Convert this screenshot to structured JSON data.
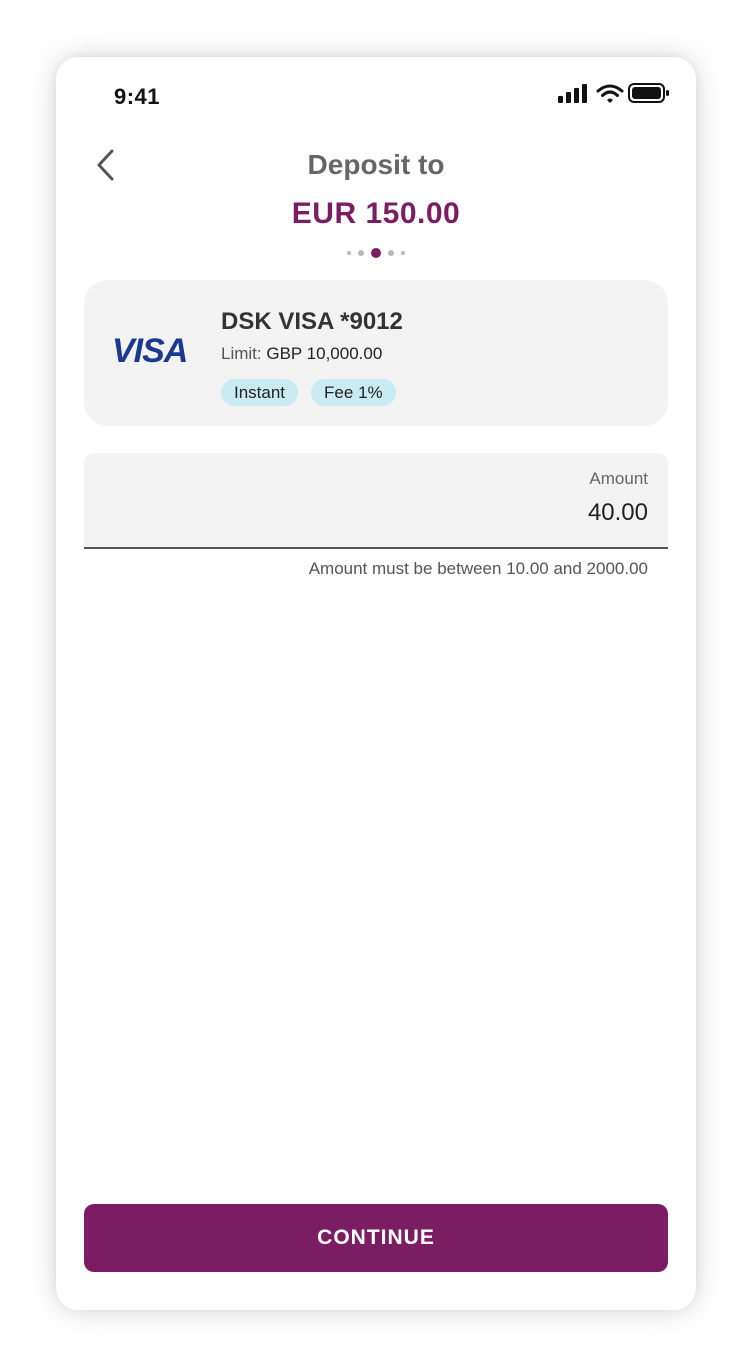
{
  "colors": {
    "brand": "#7a1d62",
    "visa": "#1a3a8f",
    "tag_bg": "#c8ecf1"
  },
  "status_bar": {
    "time": "9:41",
    "icons": [
      "signal-icon",
      "wifi-icon",
      "battery-icon"
    ]
  },
  "header": {
    "back_icon": "chevron-left-icon",
    "title": "Deposit to",
    "amount": "EUR 150.00",
    "stepper": {
      "total_steps": 5,
      "current_step": 3
    }
  },
  "payment_card": {
    "logo_text": "VISA",
    "name": "DSK VISA *9012",
    "limit_label": "Limit:",
    "limit_value": "GBP 10,000.00",
    "tags": [
      "Instant",
      "Fee 1%"
    ]
  },
  "amount_field": {
    "label": "Amount",
    "value": "40.00",
    "helper": "Amount must be between 10.00 and 2000.00"
  },
  "continue_button": {
    "label": "CONTINUE"
  }
}
